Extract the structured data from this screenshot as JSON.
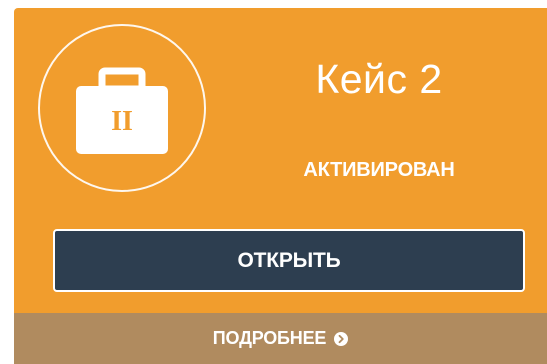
{
  "case": {
    "title": "Кейс 2",
    "status": "АКТИВИРОВАН",
    "icon": "briefcase-icon",
    "icon_mark": "II"
  },
  "actions": {
    "open_label": "ОТКРЫТЬ",
    "details_label": "ПОДРОБНЕЕ",
    "details_icon": "circle-arrow-right-icon"
  },
  "colors": {
    "card_background": "#f19d2d",
    "button_background": "#2d3e50",
    "footer_background": "#b08b5f",
    "text": "#ffffff"
  }
}
